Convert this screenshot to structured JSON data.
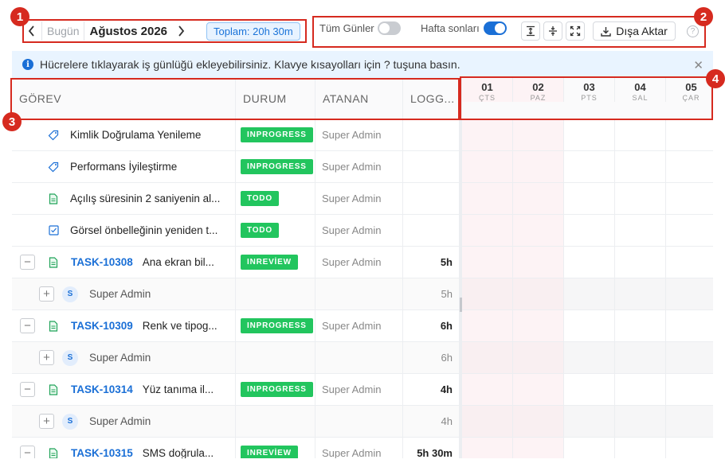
{
  "toolbar": {
    "prev_label": "<",
    "today_label": "Bugün",
    "month": "Ağustos 2026",
    "next_label": ">",
    "total": "Toplam: 20h 30m",
    "all_days_label": "Tüm Günler",
    "all_days_on": false,
    "weekends_label": "Hafta sonları",
    "weekends_on": true,
    "export_label": "Dışa Aktar",
    "help_label": "?"
  },
  "banner": {
    "message": "Hücrelere tıklayarak iş günlüğü ekleyebilirsiniz. Klavye kısayolları için ? tuşuna basın.",
    "close_label": "✕"
  },
  "columns": {
    "task": "GÖREV",
    "status": "DURUM",
    "assignee": "ATANAN",
    "logged": "LOGG..."
  },
  "days": [
    {
      "num": "01",
      "dow": "ÇTS",
      "weekend": true
    },
    {
      "num": "02",
      "dow": "PAZ",
      "weekend": true
    },
    {
      "num": "03",
      "dow": "PTS",
      "weekend": false
    },
    {
      "num": "04",
      "dow": "SAL",
      "weekend": false
    },
    {
      "num": "05",
      "dow": "ÇAR",
      "weekend": false
    }
  ],
  "rows": [
    {
      "kind": "task",
      "icon": "tag-icon",
      "name": "Kimlik Doğrulama Yenileme",
      "status": "INPROGRESS",
      "assignee": "Super Admin",
      "logged": ""
    },
    {
      "kind": "task",
      "icon": "tag-icon",
      "name": "Performans İyileştirme",
      "status": "INPROGRESS",
      "assignee": "Super Admin",
      "logged": ""
    },
    {
      "kind": "task",
      "icon": "document-icon",
      "name": "Açılış süresinin 2 saniyenin al...",
      "status": "TODO",
      "assignee": "Super Admin",
      "logged": ""
    },
    {
      "kind": "task",
      "icon": "checkbox-icon",
      "name": "Görsel önbelleğinin yeniden t...",
      "status": "TODO",
      "assignee": "Super Admin",
      "logged": ""
    },
    {
      "kind": "group",
      "icon": "document-icon",
      "key": "TASK-10308",
      "name": "Ana ekran bil...",
      "status": "INREVİEW",
      "assignee": "Super Admin",
      "logged": "5h"
    },
    {
      "kind": "user",
      "avatar": "S",
      "name": "Super Admin",
      "logged": "5h"
    },
    {
      "kind": "group",
      "icon": "document-icon",
      "key": "TASK-10309",
      "name": "Renk ve tipog...",
      "status": "INPROGRESS",
      "assignee": "Super Admin",
      "logged": "6h"
    },
    {
      "kind": "user",
      "avatar": "S",
      "name": "Super Admin",
      "logged": "6h"
    },
    {
      "kind": "group",
      "icon": "document-icon",
      "key": "TASK-10314",
      "name": "Yüz tanıma il...",
      "status": "INPROGRESS",
      "assignee": "Super Admin",
      "logged": "4h"
    },
    {
      "kind": "user",
      "avatar": "S",
      "name": "Super Admin",
      "logged": "4h"
    },
    {
      "kind": "group",
      "icon": "document-icon",
      "key": "TASK-10315",
      "name": "SMS doğrula...",
      "status": "INREVİEW",
      "assignee": "Super Admin",
      "logged": "5h 30m"
    }
  ],
  "callouts": [
    "1",
    "2",
    "3",
    "4"
  ],
  "colors": {
    "accent": "#1a6fd6",
    "status_badge": "#22c55e",
    "callout": "#d62a1f",
    "weekend": "#fdf3f5"
  }
}
